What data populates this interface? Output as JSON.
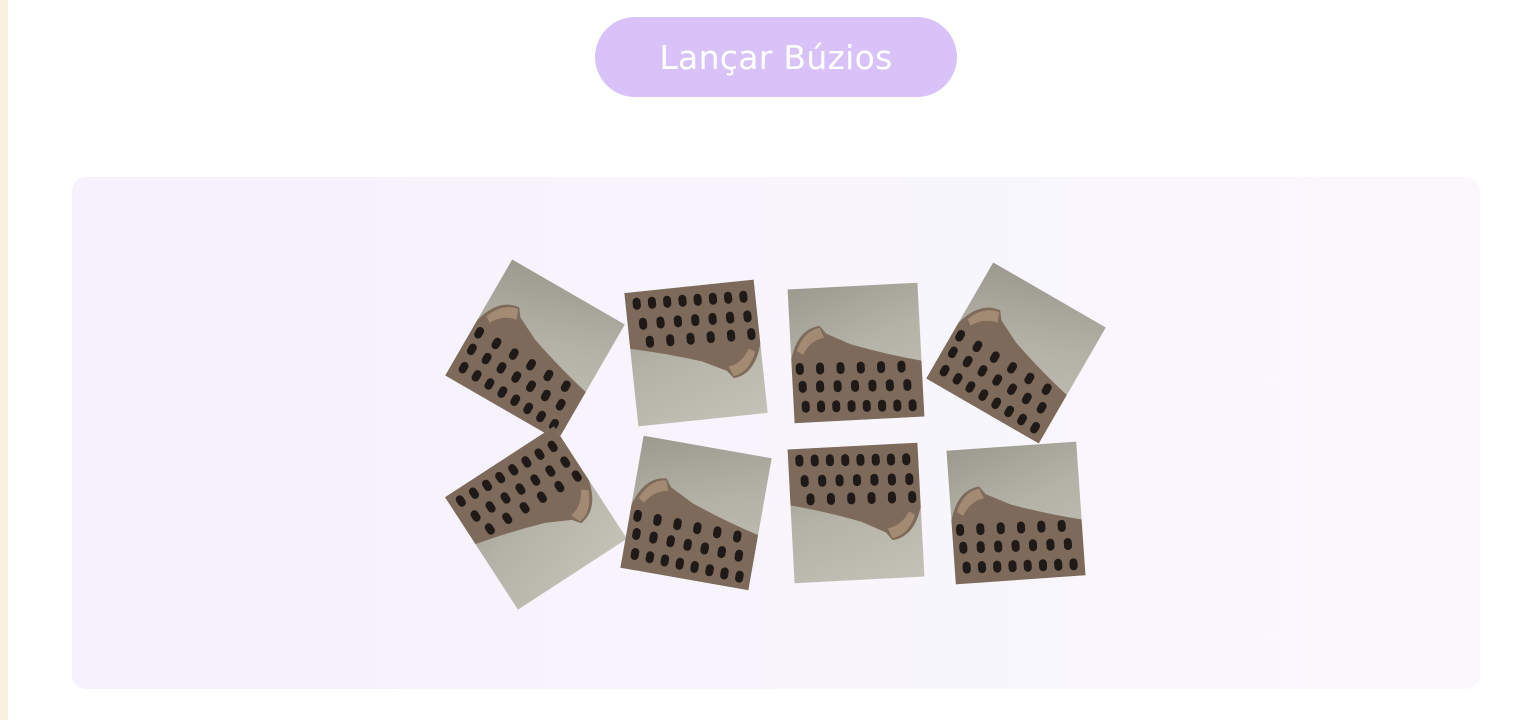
{
  "button": {
    "label": "Lançar Búzios"
  },
  "colors": {
    "button_bg": "#d8c2f8",
    "button_text": "#ffffff",
    "board_bg": "#f6f2fd",
    "left_strip": "#f8f1de"
  },
  "shells": [
    {
      "name": "shell-1",
      "icon": "colosseum-icon",
      "orientation": "up"
    },
    {
      "name": "shell-2",
      "icon": "colosseum-icon",
      "orientation": "down"
    },
    {
      "name": "shell-3",
      "icon": "colosseum-icon",
      "orientation": "up"
    },
    {
      "name": "shell-4",
      "icon": "colosseum-icon",
      "orientation": "up"
    },
    {
      "name": "shell-5",
      "icon": "colosseum-icon",
      "orientation": "down"
    },
    {
      "name": "shell-6",
      "icon": "colosseum-icon",
      "orientation": "up"
    },
    {
      "name": "shell-7",
      "icon": "colosseum-icon",
      "orientation": "down"
    },
    {
      "name": "shell-8",
      "icon": "colosseum-icon",
      "orientation": "up"
    }
  ]
}
